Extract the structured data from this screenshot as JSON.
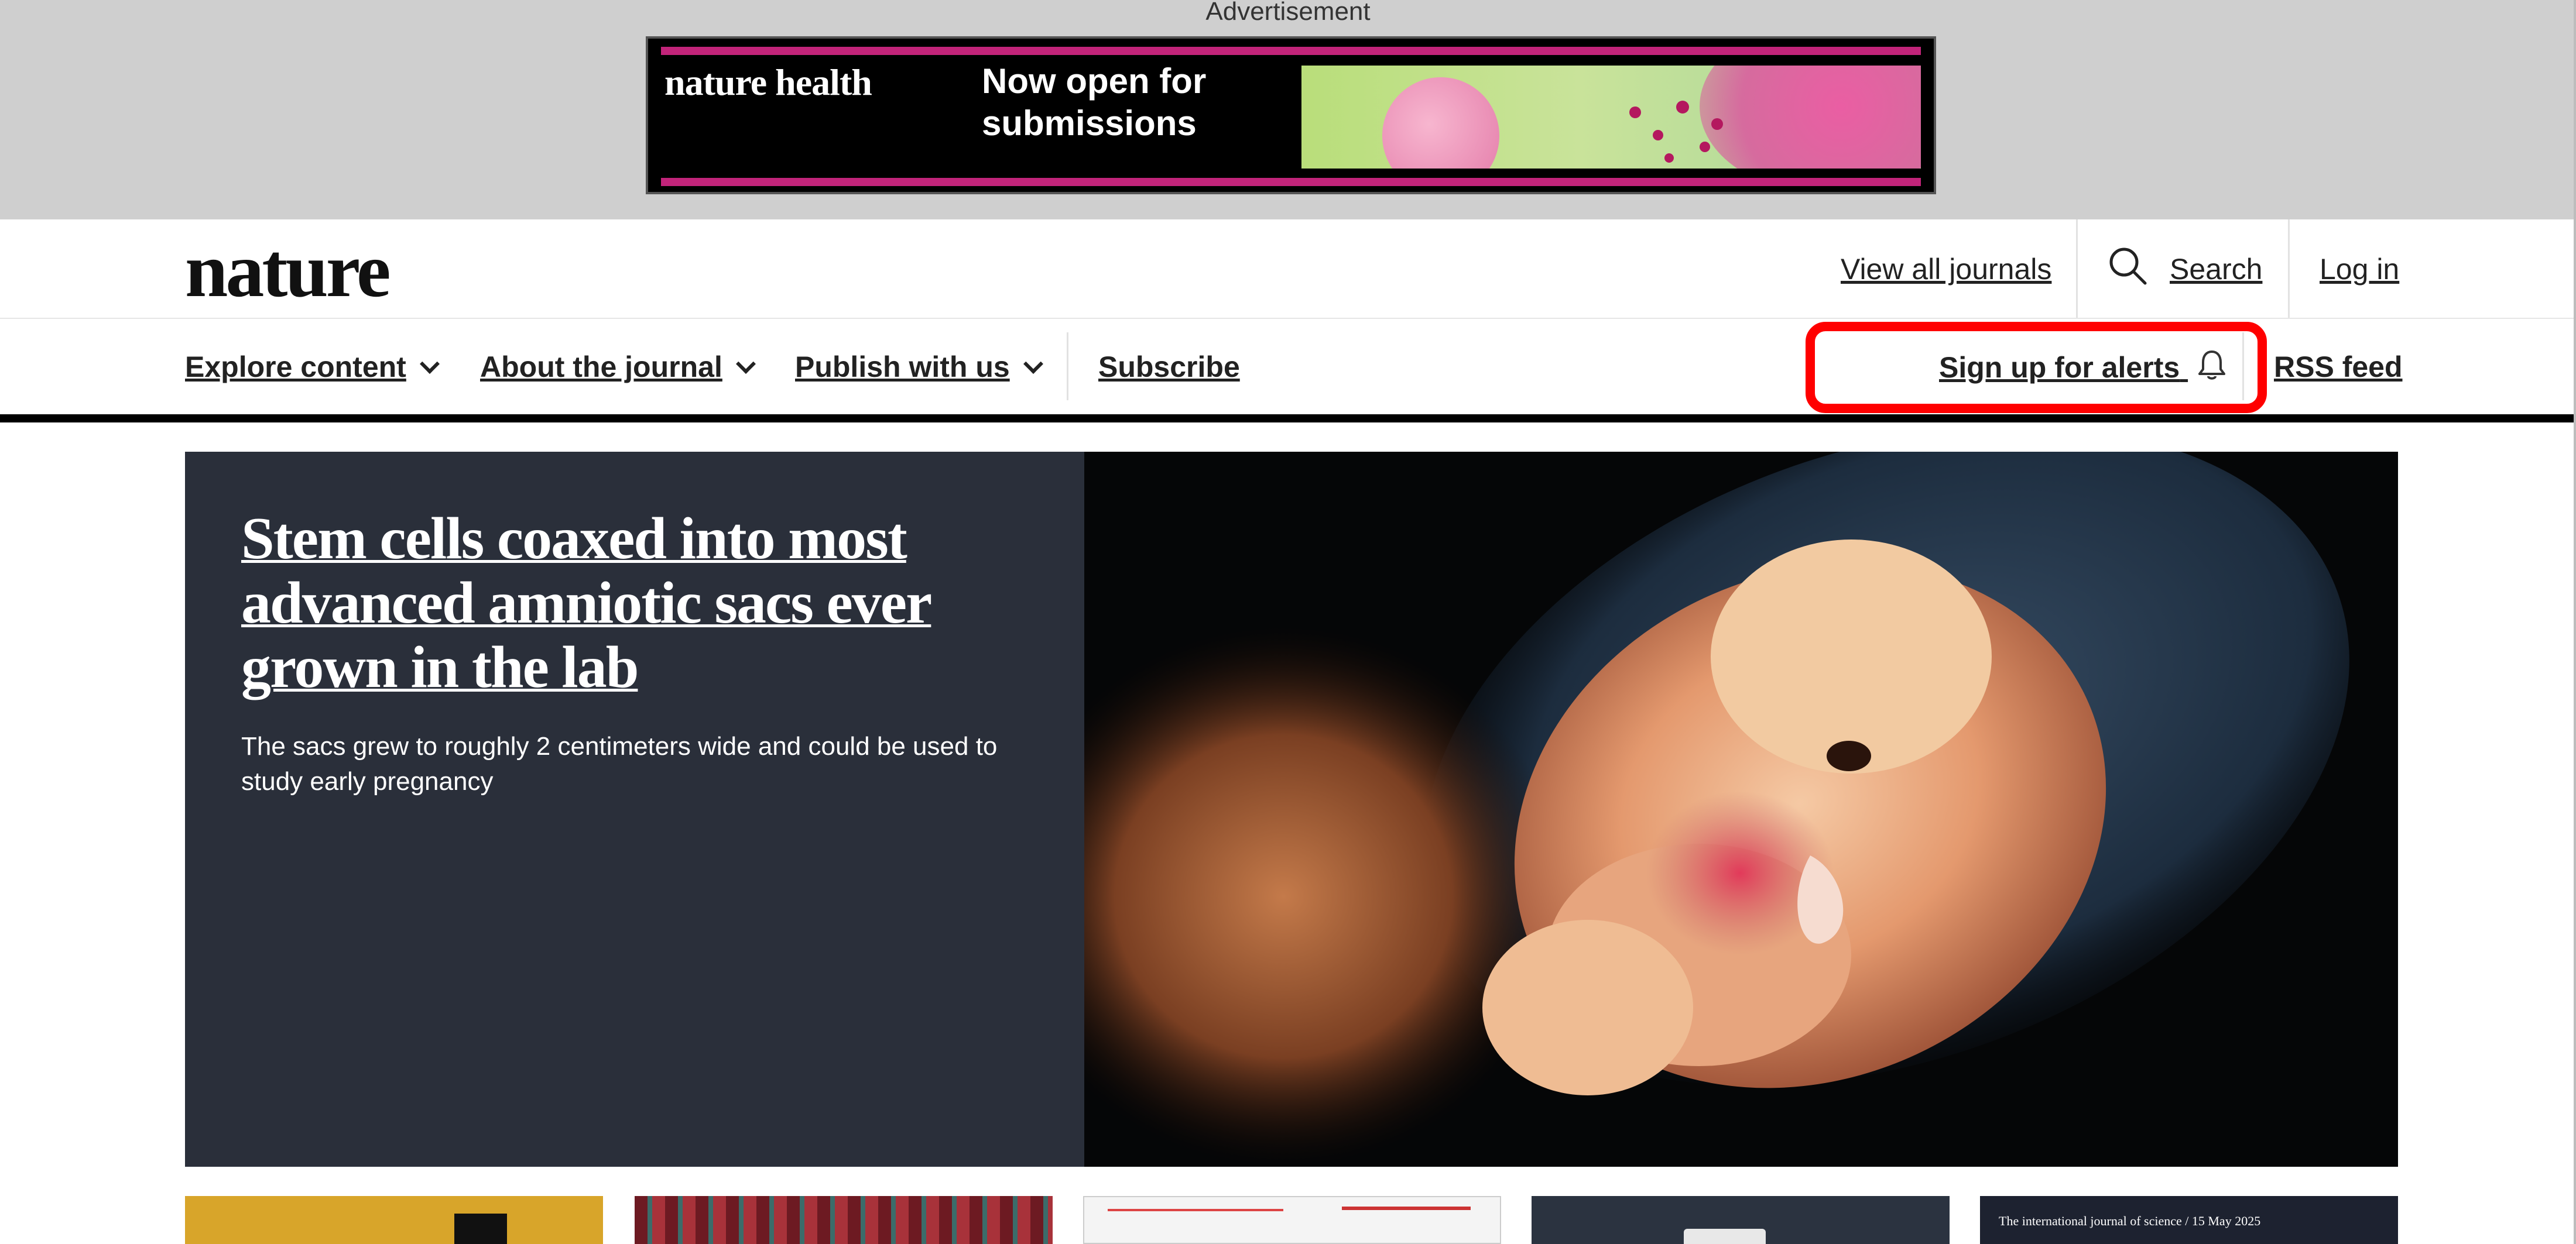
{
  "advertisement": {
    "label": "Advertisement",
    "brand": "nature health",
    "cta_line1": "Now open for",
    "cta_line2": "submissions"
  },
  "header": {
    "logo": "nature",
    "view_all_journals": "View all journals",
    "search": "Search",
    "login": "Log in"
  },
  "nav": {
    "explore": "Explore content",
    "about": "About the journal",
    "publish": "Publish with us",
    "subscribe": "Subscribe",
    "alerts": "Sign up for alerts",
    "rss": "RSS feed"
  },
  "hero": {
    "title": "Stem cells coaxed into most advanced amniotic sacs ever grown in the lab",
    "standfirst": "The sacs grew to roughly 2 centimeters wide and could be used to study early pregnancy"
  },
  "thumbnails": {
    "journal_cover_text": "The international journal of science / 15 May 2025"
  },
  "colors": {
    "highlight": "#ff0000",
    "hero_panel": "#2a2f3a",
    "ad_accent": "#c2247a",
    "ad_band": "#cfcfcf"
  },
  "icons": [
    "search-icon",
    "bell-icon",
    "chevron-down-icon"
  ]
}
